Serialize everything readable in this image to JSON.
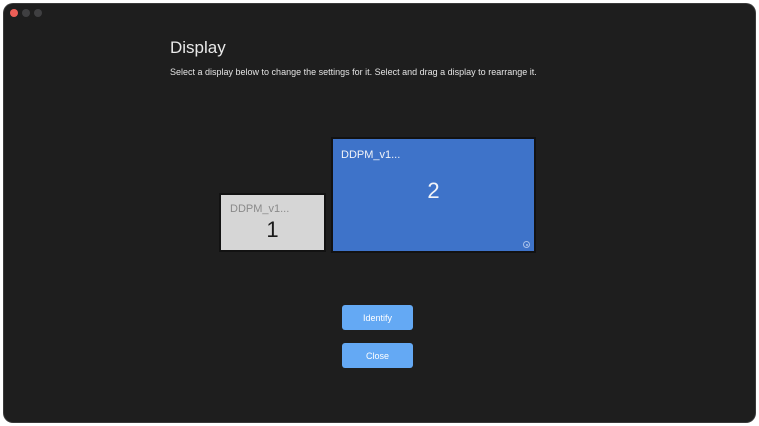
{
  "window": {
    "title": "Display",
    "subtitle": "Select a display below to change the settings for it. Select and drag a display to rearrange it."
  },
  "traffic_lights": {
    "close_color": "#ec5f57",
    "inactive_color": "#3f3f41"
  },
  "displays": [
    {
      "name": "DDPM_v1...",
      "number": "1",
      "selected": false,
      "color": "#d6d6d6"
    },
    {
      "name": "DDPM_v1...",
      "number": "2",
      "selected": true,
      "color": "#3e73c9",
      "badge_icon": "settings-badge-icon"
    }
  ],
  "buttons": {
    "identify_label": "Identify",
    "close_label": "Close",
    "color": "#64a9f4"
  }
}
